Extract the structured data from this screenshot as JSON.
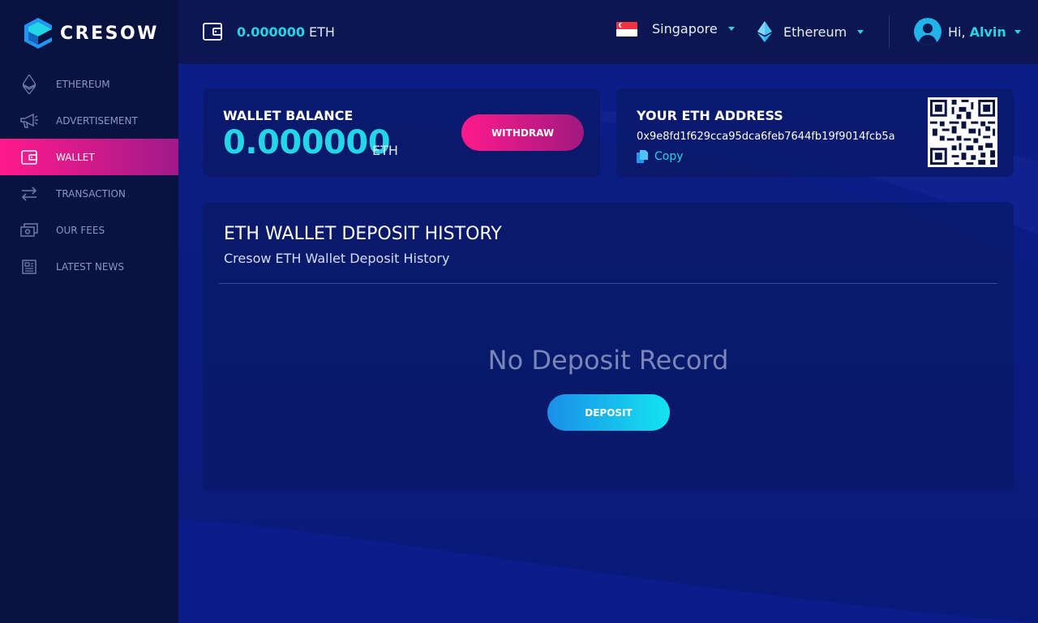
{
  "brand": {
    "name": "CRESOW"
  },
  "sidebar": {
    "items": [
      {
        "label": "ETHEREUM",
        "icon": "ethereum-icon",
        "active": false
      },
      {
        "label": "ADVERTISEMENT",
        "icon": "megaphone-icon",
        "active": false
      },
      {
        "label": "WALLET",
        "icon": "wallet-icon",
        "active": true
      },
      {
        "label": "TRANSACTION",
        "icon": "transfer-arrows-icon",
        "active": false
      },
      {
        "label": "OUR FEES",
        "icon": "cash-icon",
        "active": false
      },
      {
        "label": "LATEST NEWS",
        "icon": "newspaper-icon",
        "active": false
      }
    ]
  },
  "topbar": {
    "wallet_amount": "0.000000",
    "wallet_unit": "ETH",
    "country": "Singapore",
    "currency": "Ethereum",
    "greeting": "Hi,",
    "username": "Alvin"
  },
  "balance_card": {
    "title": "WALLET BALANCE",
    "amount": "0.000000",
    "unit": "ETH",
    "withdraw_label": "WITHDRAW"
  },
  "address_card": {
    "title": "YOUR ETH ADDRESS",
    "address": "0x9e8fd1f629cca95dca6feb7644fb19f9014fcb5a",
    "copy_label": "Copy"
  },
  "history": {
    "title": "ETH WALLET DEPOSIT HISTORY",
    "subtitle": "Cresow ETH Wallet Deposit History",
    "empty_text": "No Deposit Record",
    "deposit_label": "DEPOSIT"
  },
  "colors": {
    "accent_cyan": "#22d6e8",
    "accent_pink": "#ff1a8c",
    "sidebar_bg": "#0a1240",
    "main_bg": "#0a1a7a"
  }
}
